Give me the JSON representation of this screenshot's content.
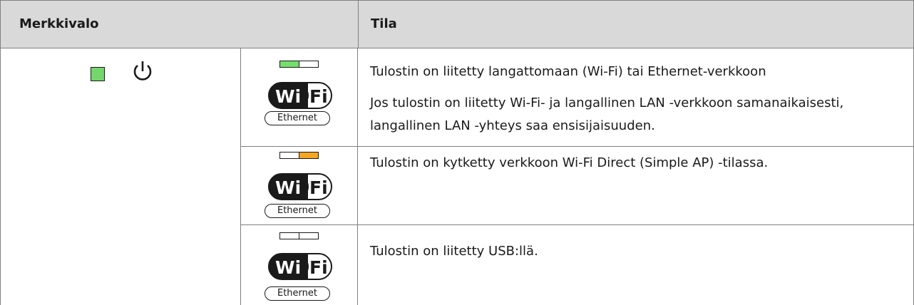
{
  "header": {
    "col_indicator": "Merkkivalo",
    "col_status": "Tila"
  },
  "power_light": {
    "color": "#74d66c",
    "icon": "power-icon"
  },
  "indicator_badge": {
    "wifi_text_wi": "Wi",
    "wifi_text_fi": "Fi",
    "ethernet_text": "Ethernet"
  },
  "rows": [
    {
      "leds": [
        "#74e06c",
        "#ffffff"
      ],
      "status_lines": [
        "Tulostin on liitetty langattomaan (Wi-Fi) tai Ethernet-verkkoon",
        "Jos tulostin on liitetty Wi-Fi- ja langallinen LAN -verkkoon samanaikaisesti,",
        "langallinen LAN -yhteys saa ensisijaisuuden."
      ]
    },
    {
      "leds": [
        "#ffffff",
        "#f5a623"
      ],
      "status_lines": [
        "Tulostin on kytketty verkkoon Wi-Fi Direct (Simple AP) -tilassa."
      ]
    },
    {
      "leds": [
        "#ffffff",
        "#ffffff"
      ],
      "status_lines": [
        "Tulostin on liitetty USB:llä."
      ]
    }
  ]
}
